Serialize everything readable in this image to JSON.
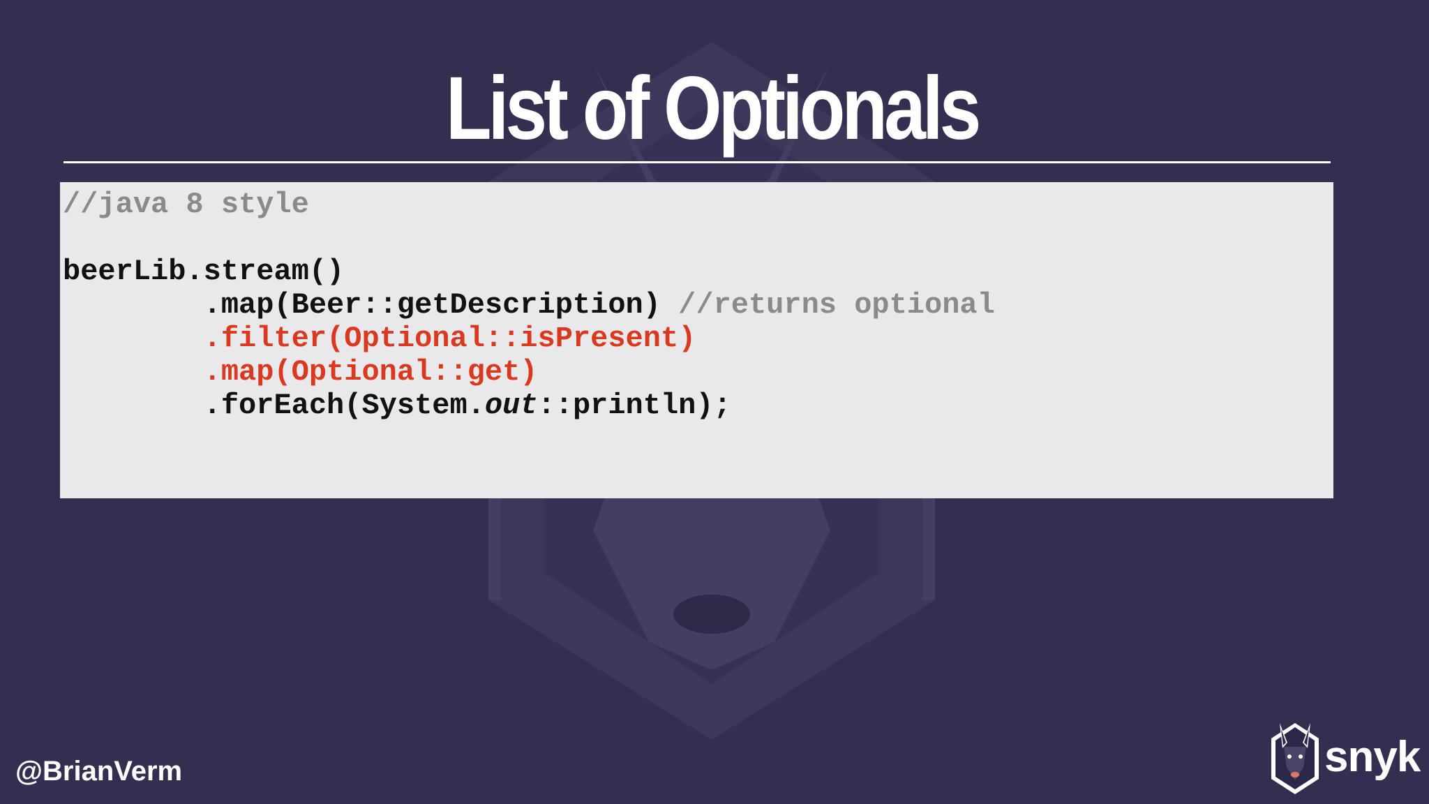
{
  "slide": {
    "title": "List of Optionals",
    "handle": "@BrianVerm",
    "logo_text": "snyk"
  },
  "code": {
    "line1_comment": "//java 8 style",
    "line3": "beerLib.stream()",
    "line4_code": "        .map(Beer::getDescription) ",
    "line4_comment": "//returns optional",
    "line5": "        .filter(Optional::isPresent)",
    "line6": "        .map(Optional::get)",
    "line7_a": "        .forEach(System.",
    "line7_b": "out",
    "line7_c": "::println);"
  },
  "colors": {
    "background": "#342f51",
    "panel": "#e9e9eb",
    "code_text": "#111111",
    "comment": "#8a8a8a",
    "highlight": "#d93a1f",
    "title": "#ffffff"
  },
  "icons": {
    "watermark": "shield-mascot-watermark-icon",
    "logo": "doberman-shield-logo-icon"
  }
}
